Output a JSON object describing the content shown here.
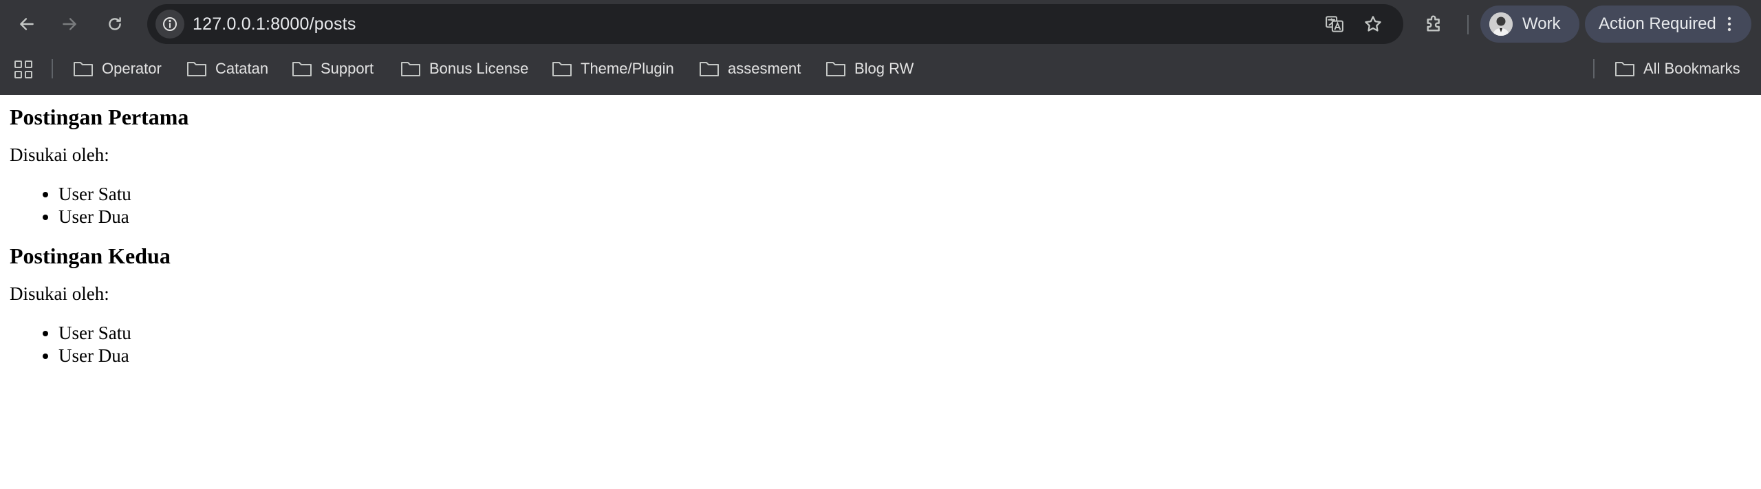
{
  "browser": {
    "url": "127.0.0.1:8000/posts",
    "profile_label": "Work",
    "action_label": "Action Required",
    "icons": {
      "back": "arrow-left-icon",
      "forward": "arrow-right-icon",
      "reload": "reload-icon",
      "site_info": "info-circle-icon",
      "translate": "translate-icon",
      "bookmark": "star-icon",
      "extensions": "puzzle-icon",
      "menu": "kebab-menu-icon",
      "apps": "grid-icon",
      "folder": "folder-icon"
    },
    "colors": {
      "chrome_bg": "#35363a",
      "omnibox_bg": "#202124",
      "chip_bg": "#44495a"
    }
  },
  "bookmarks": {
    "items": [
      {
        "label": "Operator"
      },
      {
        "label": "Catatan"
      },
      {
        "label": "Support"
      },
      {
        "label": "Bonus License"
      },
      {
        "label": "Theme/Plugin"
      },
      {
        "label": "assesment"
      },
      {
        "label": "Blog RW"
      }
    ],
    "all_bookmarks_label": "All Bookmarks"
  },
  "posts": [
    {
      "title": "Postingan Pertama",
      "liked_by_label": "Disukai oleh:",
      "likers": [
        "User Satu",
        "User Dua"
      ]
    },
    {
      "title": "Postingan Kedua",
      "liked_by_label": "Disukai oleh:",
      "likers": [
        "User Satu",
        "User Dua"
      ]
    }
  ]
}
